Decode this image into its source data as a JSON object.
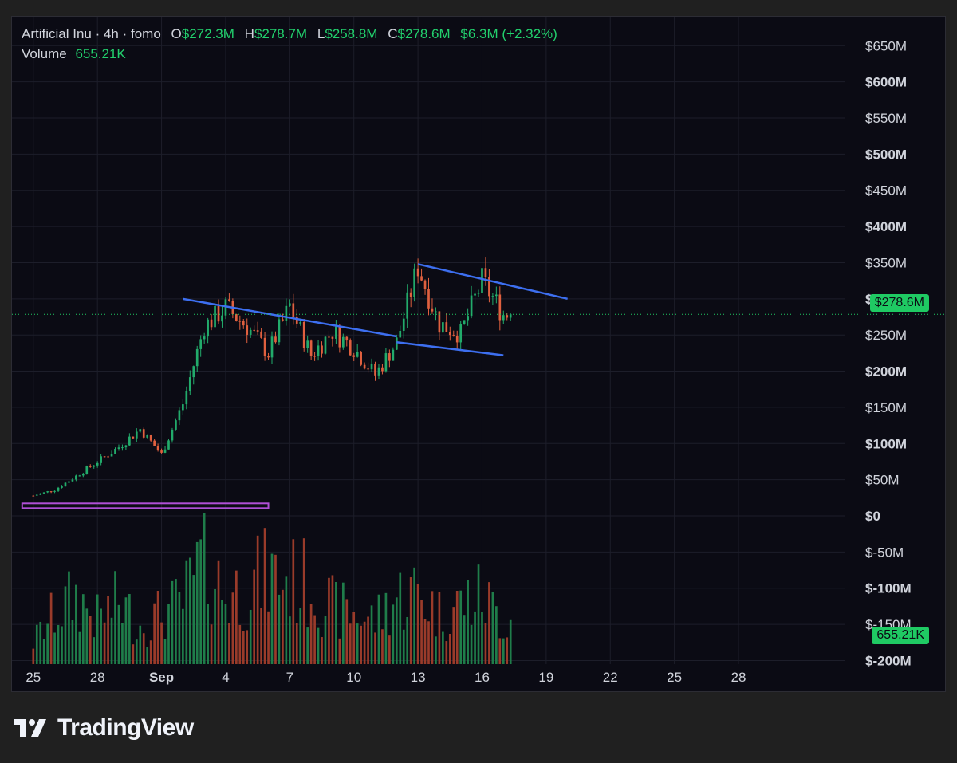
{
  "header": {
    "symbol": "Artificial Inu · 4h · fomo",
    "open_label": "O",
    "open": "$272.3M",
    "high_label": "H",
    "high": "$278.7M",
    "low_label": "L",
    "low": "$258.8M",
    "close_label": "C",
    "close": "$278.6M",
    "change": "$6.3M (+2.32%)",
    "volume_label": "Volume",
    "volume": "655.21K"
  },
  "price_tag": "$278.6M",
  "volume_tag": "655.21K",
  "footer": {
    "brand": "TradingView"
  },
  "colors": {
    "up": "#22ab6b",
    "down": "#e0603f",
    "volume_up": "#1f7d4a",
    "volume_down": "#9a3b2a",
    "trendline": "#3d6ff0",
    "marker": "#b04fd6",
    "tag": "#1fca63"
  },
  "chart_data": {
    "type": "candlestick",
    "y_axis": {
      "ticks": [
        650,
        600,
        550,
        500,
        450,
        400,
        350,
        300,
        250,
        200,
        150,
        100,
        50,
        0,
        -50,
        -100,
        -150,
        -200
      ],
      "tick_labels": [
        "$650M",
        "$600M",
        "$550M",
        "$500M",
        "$450M",
        "$400M",
        "$350M",
        "$300M",
        "$250M",
        "$200M",
        "$150M",
        "$100M",
        "$50M",
        "$0",
        "$-50M",
        "$-100M",
        "$-150M",
        "$-200M"
      ],
      "bold": [
        600,
        500,
        400,
        300,
        200,
        100,
        0,
        -100,
        -200
      ],
      "range": [
        -205,
        690
      ],
      "unit": "$M"
    },
    "x_axis": {
      "ticks": [
        "25",
        "28",
        "Sep",
        "4",
        "7",
        "10",
        "13",
        "16",
        "19",
        "22",
        "25",
        "28"
      ],
      "bold": [
        "Sep"
      ],
      "range": [
        "Aug 24",
        "Oct 2"
      ]
    },
    "last_price": 278.6,
    "grid": true,
    "trendlines": [
      {
        "from": [
          "Sep 1",
          300
        ],
        "to": [
          "Sep 11",
          248
        ]
      },
      {
        "from": [
          "Sep 11",
          240
        ],
        "to": [
          "Sep 16",
          222
        ]
      },
      {
        "from": [
          "Sep 12",
          348
        ],
        "to": [
          "Sep 19",
          300
        ]
      }
    ],
    "marker_band": {
      "from": "Aug 25",
      "to": "Sep 5",
      "value": 14
    },
    "candles_points": [
      [
        "Aug 25",
        28
      ],
      [
        "Aug 26",
        36
      ],
      [
        "Aug 27",
        55
      ],
      [
        "Aug 28",
        75
      ],
      [
        "Aug 29",
        95
      ],
      [
        "Aug 30",
        120
      ],
      [
        "Aug 31",
        85
      ],
      [
        "Sep 1",
        155
      ],
      [
        "Sep 2",
        262
      ],
      [
        "Sep 3",
        288
      ],
      [
        "Sep 4",
        262
      ],
      [
        "Sep 5",
        225
      ],
      [
        "Sep 6",
        290
      ],
      [
        "Sep 7",
        222
      ],
      [
        "Sep 8",
        255
      ],
      [
        "Sep 9",
        232
      ],
      [
        "Sep 10",
        195
      ],
      [
        "Sep 11",
        240
      ],
      [
        "Sep 12",
        345
      ],
      [
        "Sep 13",
        265
      ],
      [
        "Sep 14",
        252
      ],
      [
        "Sep 15",
        325
      ],
      [
        "Sep 16",
        278.6
      ]
    ],
    "volume_profile": [
      [
        "Aug 25",
        20
      ],
      [
        "Aug 26",
        45
      ],
      [
        "Aug 27",
        60
      ],
      [
        "Aug 28",
        40
      ],
      [
        "Aug 29",
        55
      ],
      [
        "Aug 30",
        35
      ],
      [
        "Aug 31",
        45
      ],
      [
        "Sep 1",
        55
      ],
      [
        "Sep 2",
        95
      ],
      [
        "Sep 3",
        60
      ],
      [
        "Sep 4",
        70
      ],
      [
        "Sep 5",
        80
      ],
      [
        "Sep 6",
        75
      ],
      [
        "Sep 7",
        70
      ],
      [
        "Sep 8",
        50
      ],
      [
        "Sep 9",
        45
      ],
      [
        "Sep 10",
        40
      ],
      [
        "Sep 11",
        60
      ],
      [
        "Sep 12",
        65
      ],
      [
        "Sep 13",
        45
      ],
      [
        "Sep 14",
        55
      ],
      [
        "Sep 15",
        60
      ],
      [
        "Sep 16",
        40
      ]
    ]
  }
}
